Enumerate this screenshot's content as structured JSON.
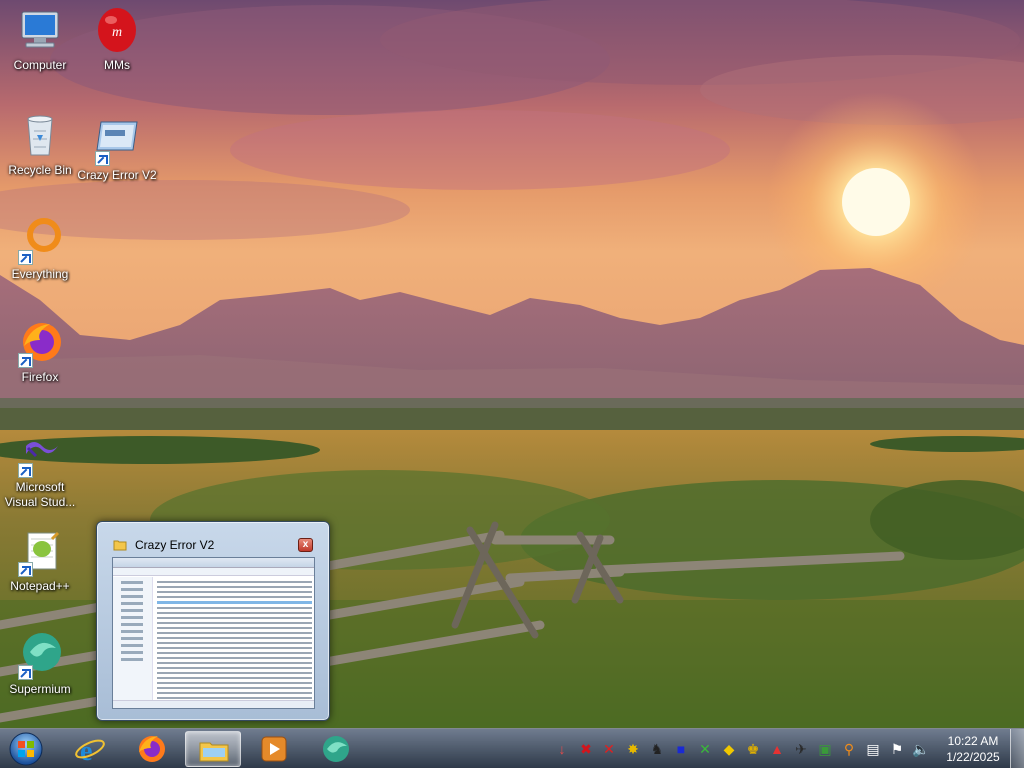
{
  "desktop": {
    "icons": [
      {
        "label": "Computer",
        "icon": "computer-icon"
      },
      {
        "label": "MMs",
        "icon": "mms-icon"
      },
      {
        "label": "Recycle Bin",
        "icon": "recycle-bin-icon"
      },
      {
        "label": "Crazy Error V2",
        "icon": "crazy-error-icon"
      },
      {
        "label": "Everything",
        "icon": "everything-icon"
      },
      {
        "label": "Firefox",
        "icon": "firefox-icon"
      },
      {
        "label": "Microsoft Visual Stud...",
        "icon": "visual-studio-icon"
      },
      {
        "label": "Notepad++",
        "icon": "notepadpp-icon"
      },
      {
        "label": "Supermium",
        "icon": "supermium-icon"
      }
    ]
  },
  "preview": {
    "title": "Crazy Error V2",
    "close_label": "x"
  },
  "taskbar": {
    "pinned": [
      {
        "name": "Internet Explorer",
        "icon": "internet-explorer-icon"
      },
      {
        "name": "Firefox",
        "icon": "firefox-icon"
      },
      {
        "name": "Windows Explorer",
        "icon": "windows-explorer-icon",
        "active": true
      },
      {
        "name": "Media Player",
        "icon": "media-player-icon"
      },
      {
        "name": "Supermium",
        "icon": "supermium-icon"
      }
    ],
    "clock": {
      "time": "10:22 AM",
      "date": "1/22/2025"
    }
  },
  "colors": {
    "accent": "#1a5fc4",
    "close_red": "#c0392b"
  }
}
